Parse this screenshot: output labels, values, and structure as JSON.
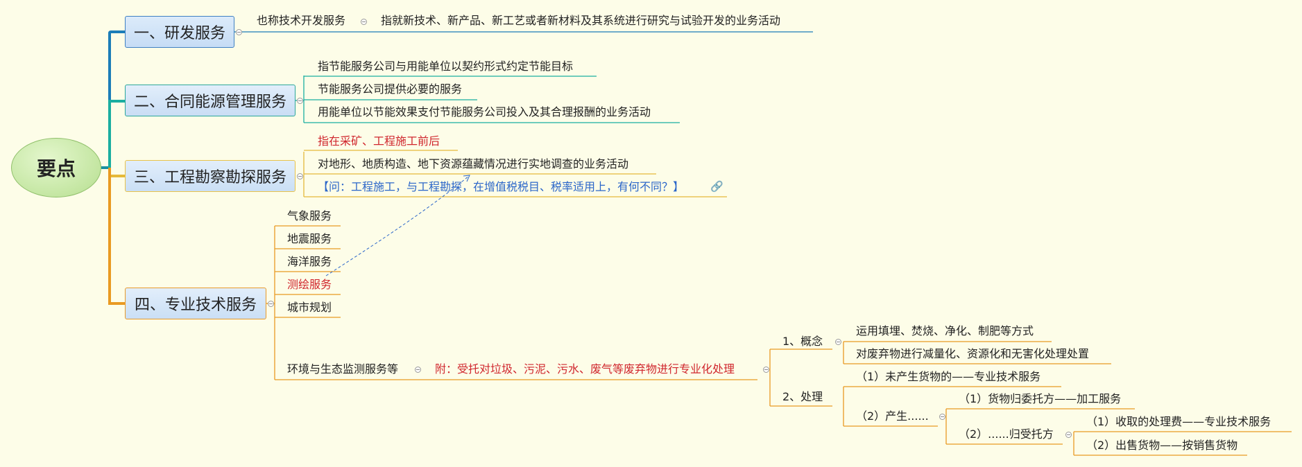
{
  "root": {
    "label": "要点"
  },
  "branches": [
    {
      "label": "一、研发服务",
      "subs": [
        {
          "label": "也称技术开发服务"
        },
        {
          "label": "指就新技术、新产品、新工艺或者新材料及其系统进行研究与试验开发的业务活动"
        }
      ]
    },
    {
      "label": "二、合同能源管理服务",
      "subs": [
        {
          "label": "指节能服务公司与用能单位以契约形式约定节能目标"
        },
        {
          "label": "节能服务公司提供必要的服务"
        },
        {
          "label": "用能单位以节能效果支付节能服务公司投入及其合理报酬的业务活动"
        }
      ]
    },
    {
      "label": "三、工程勘察勘探服务",
      "subs": [
        {
          "label": "指在采矿、工程施工前后"
        },
        {
          "label": "对地形、地质构造、地下资源蕴藏情况进行实地调查的业务活动"
        },
        {
          "label": "【问：工程施工，与工程勘探，在增值税税目、税率适用上，有何不同？】"
        }
      ]
    },
    {
      "label": "四、专业技术服务",
      "subs": [
        {
          "label": "气象服务"
        },
        {
          "label": "地震服务"
        },
        {
          "label": "海洋服务"
        },
        {
          "label": "测绘服务"
        },
        {
          "label": "城市规划"
        },
        {
          "label": "环境与生态监测服务等"
        }
      ],
      "appendix": {
        "label": "附：受托对垃圾、污泥、污水、废气等废弃物进行专业化处理",
        "concept": {
          "label": "1、概念",
          "items": [
            "运用填埋、焚烧、净化、制肥等方式",
            "对废弃物进行减量化、资源化和无害化处理处置"
          ]
        },
        "process": {
          "label": "2、处理",
          "no_goods": "（1）未产生货物的——专业技术服务",
          "produce": {
            "label": "（2）产生......",
            "to_client": "（1）货物归委托方——加工服务",
            "to_agent": {
              "label": "（2）......归受托方",
              "fee": "（1）收取的处理费——专业技术服务",
              "sale": "（2）出售货物——按销售货物"
            }
          }
        }
      }
    }
  ],
  "colors": {
    "b1": "#1b7db8",
    "b2": "#1aaea0",
    "b3": "#e5b93a",
    "b4": "#e99a22",
    "red": "#d0262d",
    "link": "#2b66c9"
  },
  "icons": {
    "collapse": "collapse-minus-icon",
    "link": "link-chain-icon"
  }
}
